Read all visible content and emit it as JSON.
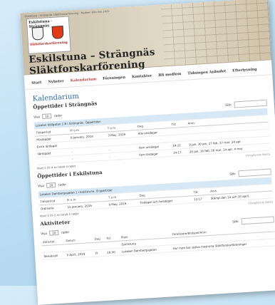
{
  "banner": {
    "top_line": "Eskilstuna - Strängnäs Släktforskarförening - Medlem  Riks Sök 2021",
    "logo_title": "Eskilstuna · Strängnäs",
    "logo_sub": "Släktforskarförening",
    "site_title": "Eskilstuna – Strängnäs Släktforskarförening"
  },
  "nav": [
    "Start",
    "Nyheter",
    "Kalendarium",
    "Föreningen",
    "Kontakter",
    "Bli medlem",
    "Tidningen Anbudet",
    "Efterlysning"
  ],
  "page": {
    "title": "Kalendarium"
  },
  "sections": [
    {
      "title": "Öppettider i Strängnäs",
      "show_label": "Visa",
      "show_value": "10",
      "show_suffix": "rader",
      "search_label": "Sök:",
      "caption": "Lokalen Källgatan 1 B i Strängnäs. Öppettider",
      "headers": [
        "Tidsperiod",
        "Fr o m",
        "T o m",
        "Dag",
        "Tid",
        "Anm."
      ],
      "rows": [
        [
          "Höstöppet",
          "8 January, 2019",
          "3 May, 2019",
          "Alla onsdagar",
          "",
          ""
        ],
        [
          "Extra lördagar",
          "",
          "",
          "",
          "",
          ""
        ],
        [
          "Vårlöppet",
          "-",
          "-",
          "Fem onsdagar",
          "14-21",
          "9 jan, 30 jan, 27 feb, 27 mar, 24 apr"
        ],
        [
          "",
          "-",
          "-",
          "Fem lördagar",
          "14-17",
          "26 jan, 16 feb, 16 mar, 14 apr, 4 maj"
        ]
      ],
      "info": "Visar 1 till 4 av totalt 4 rader",
      "pager": "Föregående  Nästa"
    },
    {
      "title": "Öppettider i Eskilstuna",
      "show_label": "Visa",
      "show_value": "10",
      "show_suffix": "rader",
      "search_label": "Sök:",
      "caption": "Lokalen Dambergsgatan 1 i Eskilstuna. Ö ppettider",
      "headers": [
        "Tidsperiod",
        "Fr o m",
        "T o m",
        "Dag",
        "Tid",
        "Anm."
      ],
      "rows": [
        [
          "Ordinarie",
          "15 January, 2019",
          "9 May, 2019",
          "Tisdagar och torsdagar",
          "13-17",
          "Stängt den 14 och 30 april."
        ]
      ],
      "info": "Visar 1 till 2 av totalt 2 rader",
      "pager": "Föregående  Nästa"
    },
    {
      "title": "Aktiviteter",
      "show_label": "Visa",
      "show_value": "10",
      "show_suffix": "rader",
      "search_label": "Sök:",
      "caption": "",
      "headers": [
        "Aktivitet",
        "Datum",
        "Dag",
        "Tid",
        "Plats",
        "Föreläsare/Bildspel/Anm"
      ],
      "rows": [
        [
          "",
          "",
          "",
          "",
          "Eskilstuna",
          ""
        ],
        [
          "Temakväll",
          "5 April, 2019",
          "Fr",
          "18.00",
          "Lokalen Dambergsgatan",
          "Hur man bor själva med sina Släktforskarföreningar"
        ]
      ],
      "info": "",
      "pager": ""
    }
  ]
}
